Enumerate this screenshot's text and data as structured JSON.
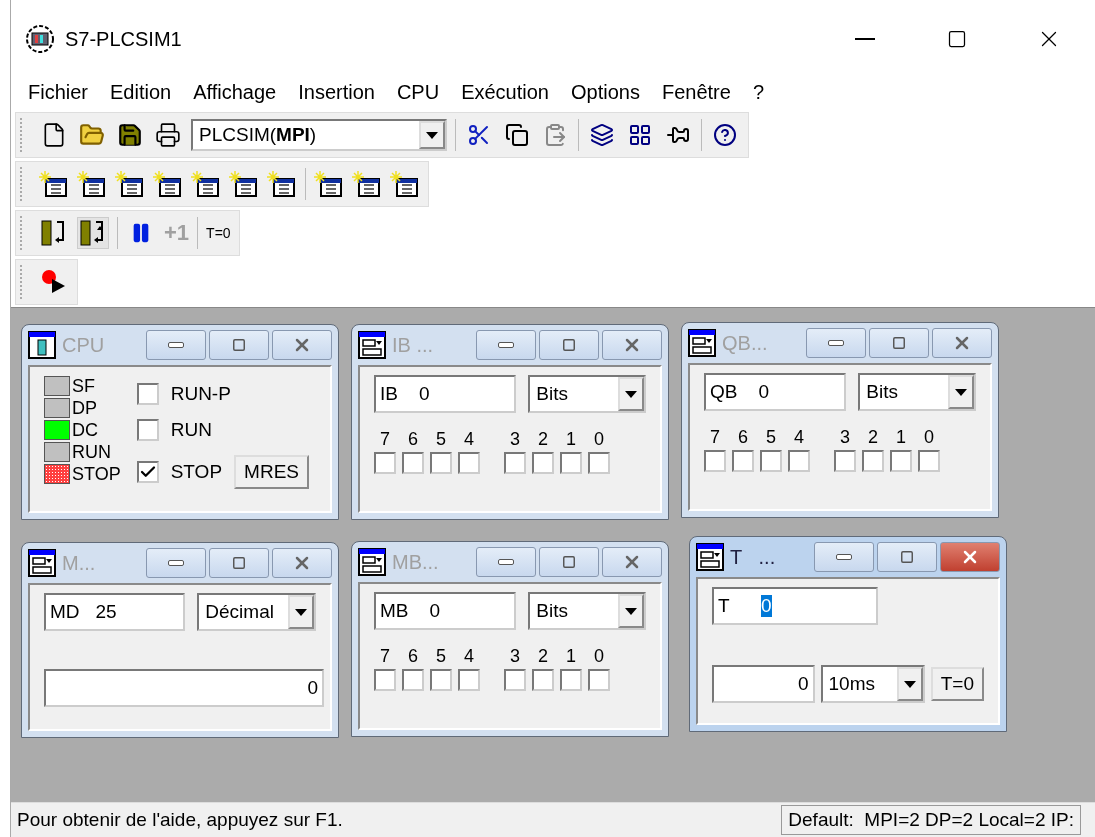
{
  "window": {
    "title": "S7-PLCSIM1"
  },
  "menu": [
    "Fichier",
    "Edition",
    "Affichage",
    "Insertion",
    "CPU",
    "Exécution",
    "Options",
    "Fenêtre",
    "?"
  ],
  "toolbar": {
    "connection": "PLCSIM(**MPI**)",
    "step_label": "+1",
    "step_disabled": true,
    "reset_label": "T=0"
  },
  "subwindows": [
    {
      "kind": "cpu",
      "title": "CPU",
      "active": false,
      "leds": [
        {
          "label": "SF",
          "color": "#c0c0c0"
        },
        {
          "label": "DP",
          "color": "#c0c0c0"
        },
        {
          "label": "DC",
          "color": "#00ff00"
        },
        {
          "label": "RUN",
          "color": "#c0c0c0"
        },
        {
          "label": "STOP",
          "color": "#ff4040"
        }
      ],
      "modes": [
        {
          "label": "RUN-P",
          "checked": false
        },
        {
          "label": "RUN",
          "checked": false
        },
        {
          "label": "STOP",
          "checked": true
        }
      ],
      "button": "MRES"
    },
    {
      "kind": "bits",
      "title": "IB ...",
      "active": false,
      "address": "IB    0",
      "format": "Bits",
      "bits": [
        {
          "label": "7",
          "checked": false
        },
        {
          "label": "6",
          "checked": false
        },
        {
          "label": "5",
          "checked": false
        },
        {
          "label": "4",
          "checked": false
        },
        {
          "label": "3",
          "checked": false
        },
        {
          "label": "2",
          "checked": false
        },
        {
          "label": "1",
          "checked": false
        },
        {
          "label": "0",
          "checked": false
        }
      ]
    },
    {
      "kind": "bits",
      "title": "QB...",
      "active": false,
      "address": "QB    0",
      "format": "Bits",
      "bits": [
        {
          "label": "7",
          "checked": false
        },
        {
          "label": "6",
          "checked": false
        },
        {
          "label": "5",
          "checked": false
        },
        {
          "label": "4",
          "checked": false
        },
        {
          "label": "3",
          "checked": false
        },
        {
          "label": "2",
          "checked": false
        },
        {
          "label": "1",
          "checked": false
        },
        {
          "label": "0",
          "checked": false
        }
      ]
    },
    {
      "kind": "value",
      "title": "M...",
      "active": false,
      "address": "MD   25",
      "format": "Décimal",
      "value": "0"
    },
    {
      "kind": "bits",
      "title": "MB...",
      "active": false,
      "address": "MB    0",
      "format": "Bits",
      "bits": [
        {
          "label": "7",
          "checked": false
        },
        {
          "label": "6",
          "checked": false
        },
        {
          "label": "5",
          "checked": false
        },
        {
          "label": "4",
          "checked": false
        },
        {
          "label": "3",
          "checked": false
        },
        {
          "label": "2",
          "checked": false
        },
        {
          "label": "1",
          "checked": false
        },
        {
          "label": "0",
          "checked": false
        }
      ]
    },
    {
      "kind": "timer",
      "title": "T   ...",
      "active": true,
      "address": "T",
      "index": "0",
      "index_selected": true,
      "value": "0",
      "base": "10ms",
      "button": "T=0"
    }
  ],
  "status_bar": {
    "message": "Pour obtenir de l'aide, appuyez sur F1.",
    "connection": "Default:  MPI=2 DP=2 Local=2 IP:"
  }
}
